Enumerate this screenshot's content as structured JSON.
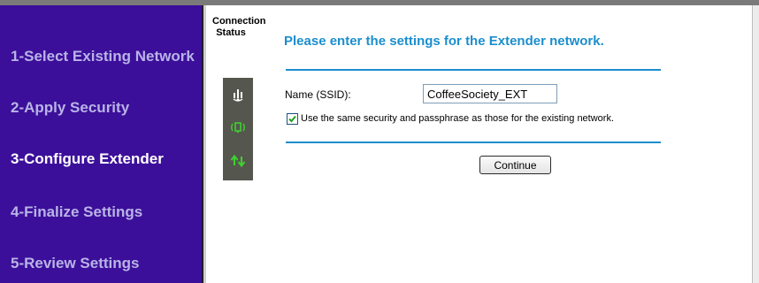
{
  "sidebar": {
    "steps": [
      {
        "label": "1-Select Existing Network",
        "active": false
      },
      {
        "label": "2-Apply Security",
        "active": false
      },
      {
        "label": "3-Configure Extender",
        "active": true
      },
      {
        "label": "4-Finalize Settings",
        "active": false
      },
      {
        "label": "5-Review Settings",
        "active": false
      }
    ]
  },
  "status": {
    "label": "Connection Status",
    "icons": [
      "signal-bars-icon",
      "wireless-device-icon",
      "transfer-arrows-icon"
    ]
  },
  "main": {
    "heading": "Please enter the settings for the Extender network.",
    "ssid_label": "Name (SSID):",
    "ssid_value": "CoffeeSociety_EXT",
    "same_security_label": "Use the same security and passphrase as those for the existing network.",
    "same_security_checked": true,
    "continue_label": "Continue"
  },
  "colors": {
    "sidebar_bg": "#3c0f9a",
    "inactive_step": "#b9b4e7",
    "active_step": "#ffffff",
    "accent_blue": "#1b8ecd",
    "status_panel": "#55574f",
    "icon_green": "#3fd12e"
  }
}
